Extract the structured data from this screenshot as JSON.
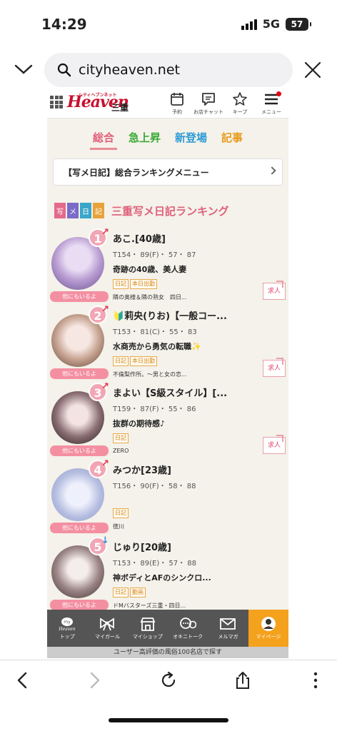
{
  "status": {
    "time": "14:29",
    "network": "5G",
    "battery": "57"
  },
  "browser": {
    "url": "cityheaven.net",
    "icons": [
      "chevron-down-icon",
      "search-icon",
      "close-icon"
    ]
  },
  "site": {
    "logo_text": "Heaven",
    "logo_sub": "シティヘブンネット",
    "region": "三重",
    "header_icons": [
      {
        "icon": "calendar-icon",
        "label": "予約"
      },
      {
        "icon": "chat-icon",
        "label": "お店チャット"
      },
      {
        "icon": "star-icon",
        "label": "キープ"
      },
      {
        "icon": "menu-icon",
        "label": "メニュー"
      }
    ],
    "tabs": [
      {
        "label": "総合",
        "color": "#e0607a"
      },
      {
        "label": "急上昇",
        "color": "#3aaa35"
      },
      {
        "label": "新登場",
        "color": "#2e9bd6"
      },
      {
        "label": "記事",
        "color": "#e89a1c"
      }
    ],
    "ranking_menu": "【写メ日記】総合ランキングメニュー",
    "ranking_title": "三重写メ日記ランキング",
    "title_blocks": [
      {
        "char": "写",
        "color": "#e46a8a"
      },
      {
        "char": "メ",
        "color": "#7b6bc8"
      },
      {
        "char": "日",
        "color": "#3aa6c9"
      },
      {
        "char": "記",
        "color": "#e8a23a"
      }
    ],
    "other_label": "他にもいるよ",
    "kyujin_label": "求人",
    "entries": [
      {
        "rank": "1",
        "trend": "up",
        "name": "あこ.[40歳]",
        "specs": "T154・ 89(F)・ 57・ 87",
        "catch": "奇跡の40歳、美人妻",
        "tags": [
          "日記",
          "本日出勤"
        ],
        "shop": "隣の奥様＆隣の熟女　四日...",
        "kyujin": true
      },
      {
        "rank": "2",
        "trend": "up",
        "name": "🔰莉央(りお)【一般コー...",
        "specs": "T153・ 81(C)・ 55・ 83",
        "catch": "水商売から勇気の転職✨",
        "tags": [
          "日記",
          "本日出勤"
        ],
        "shop": "不倫梨作所。～男と女の恋...",
        "kyujin": true
      },
      {
        "rank": "3",
        "trend": "up",
        "name": "まよい【S級スタイル】[...",
        "specs": "T159・ 87(F)・ 55・ 86",
        "catch": "抜群の期待感♪",
        "tags": [
          "日記"
        ],
        "shop": "ZERO",
        "kyujin": true
      },
      {
        "rank": "4",
        "trend": "up",
        "name": "みつか[23歳]",
        "specs": "T156・ 90(F)・ 58・ 88",
        "catch": "",
        "tags": [
          "日記"
        ],
        "shop": "徳川",
        "kyujin": false
      },
      {
        "rank": "5",
        "trend": "down",
        "name": "じゅり[20歳]",
        "specs": "T153・ 89(E)・ 57・ 88",
        "catch": "神ボディとAFのシンクロ...",
        "tags": [
          "日記",
          "動画"
        ],
        "shop": "ドMバスターズ三重・四日...",
        "kyujin": false
      }
    ],
    "bottom_nav": [
      {
        "icon": "myheaven-icon",
        "label": "トップ",
        "active": false
      },
      {
        "icon": "ribbon-icon",
        "label": "マイガール",
        "active": false
      },
      {
        "icon": "shop-icon",
        "label": "マイショップ",
        "active": false
      },
      {
        "icon": "chat-bubbles-icon",
        "label": "オキニトーク",
        "active": false
      },
      {
        "icon": "mail-icon",
        "label": "メルマガ",
        "active": false
      },
      {
        "icon": "user-avatar-icon",
        "label": "マイページ",
        "active": true
      }
    ],
    "banner": "ユーザー高評価の風俗100名店で探す"
  },
  "toolbar": {
    "icons": [
      "back-icon",
      "forward-icon",
      "reload-icon",
      "share-icon",
      "more-icon"
    ]
  }
}
